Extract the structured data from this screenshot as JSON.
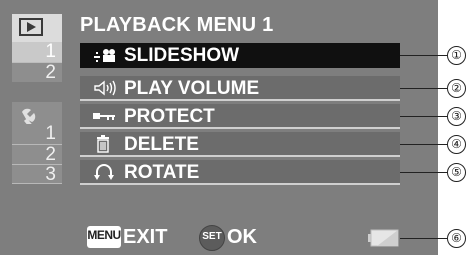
{
  "tabs": {
    "playback_tab_numbers": [
      "1",
      "2"
    ],
    "setup_tab_numbers": [
      "1",
      "2",
      "3"
    ]
  },
  "menu": {
    "title": "PLAYBACK MENU 1",
    "items": [
      {
        "label": "SLIDESHOW",
        "icon": "slideshow-icon"
      },
      {
        "label": "PLAY VOLUME",
        "icon": "speaker-icon"
      },
      {
        "label": "PROTECT",
        "icon": "key-icon"
      },
      {
        "label": "DELETE",
        "icon": "trash-icon"
      },
      {
        "label": "ROTATE",
        "icon": "rotate-icon"
      }
    ],
    "selected_index": 0
  },
  "footer": {
    "menu_key": "MENU",
    "exit_label": "EXIT",
    "set_key": "SET",
    "ok_label": "OK",
    "battery_icon": "battery-icon"
  },
  "callouts": [
    "①",
    "②",
    "③",
    "④",
    "⑤",
    "⑥"
  ],
  "colors": {
    "screen_bg": "#7e7e7e",
    "selected_bg": "#101010",
    "item_bg": "#6c6c6c",
    "text": "#ffffff"
  }
}
